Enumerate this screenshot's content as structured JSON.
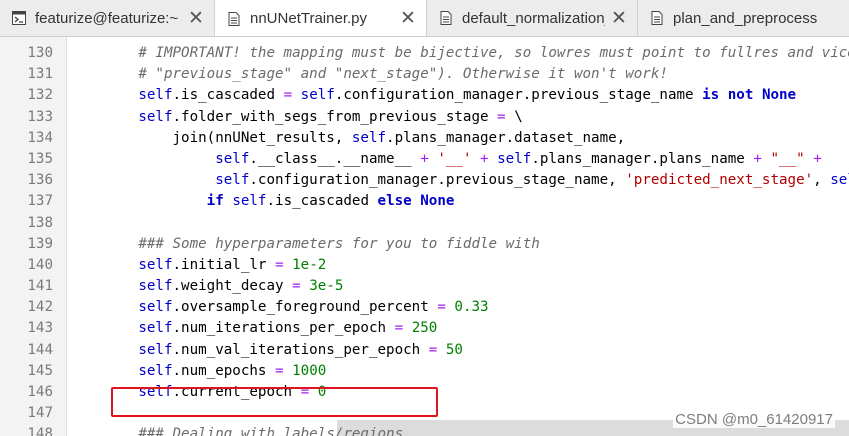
{
  "tabs": [
    {
      "label": "featurize@featurize:~",
      "icon": "terminal-icon",
      "active": false
    },
    {
      "label": "nnUNetTrainer.py",
      "icon": "file-icon",
      "active": true
    },
    {
      "label": "default_normalization_schemes.py",
      "icon": "file-icon",
      "active": false
    },
    {
      "label": "plan_and_preprocess",
      "icon": "file-icon",
      "active": false
    }
  ],
  "editor": {
    "lines": [
      {
        "n": "130",
        "src": "        # IMPORTANT! the mapping must be bijective, so lowres must point to fullres and vice versa"
      },
      {
        "n": "131",
        "src": "        # \"previous_stage\" and \"next_stage\"). Otherwise it won't work!"
      },
      {
        "n": "132",
        "src": "        self.is_cascaded = self.configuration_manager.previous_stage_name is not None"
      },
      {
        "n": "133",
        "src": "        self.folder_with_segs_from_previous_stage = \\"
      },
      {
        "n": "134",
        "src": "            join(nnUNet_results, self.plans_manager.dataset_name,"
      },
      {
        "n": "135",
        "src": "                 self.__class__.__name__ + '__' + self.plans_manager.plans_name + \"__\" +"
      },
      {
        "n": "136",
        "src": "                 self.configuration_manager.previous_stage_name, 'predicted_next_stage', self.configuration_name) \\"
      },
      {
        "n": "137",
        "src": "                if self.is_cascaded else None"
      },
      {
        "n": "138",
        "src": ""
      },
      {
        "n": "139",
        "src": "        ### Some hyperparameters for you to fiddle with"
      },
      {
        "n": "140",
        "src": "        self.initial_lr = 1e-2"
      },
      {
        "n": "141",
        "src": "        self.weight_decay = 3e-5"
      },
      {
        "n": "142",
        "src": "        self.oversample_foreground_percent = 0.33"
      },
      {
        "n": "143",
        "src": "        self.num_iterations_per_epoch = 250"
      },
      {
        "n": "144",
        "src": "        self.num_val_iterations_per_epoch = 50"
      },
      {
        "n": "145",
        "src": "        self.num_epochs = 1000"
      },
      {
        "n": "146",
        "src": "        self.current_epoch = 0"
      },
      {
        "n": "147",
        "src": ""
      },
      {
        "n": "148",
        "src": "        ### Dealing with labels/regions"
      }
    ]
  },
  "watermark": "CSDN @m0_61420917",
  "colors": {
    "keyword": "#0000c8",
    "comment": "#6b6b6b",
    "number": "#008000",
    "string": "#b00000",
    "operator": "#a020f0",
    "highlight_box": "#e0141e"
  }
}
